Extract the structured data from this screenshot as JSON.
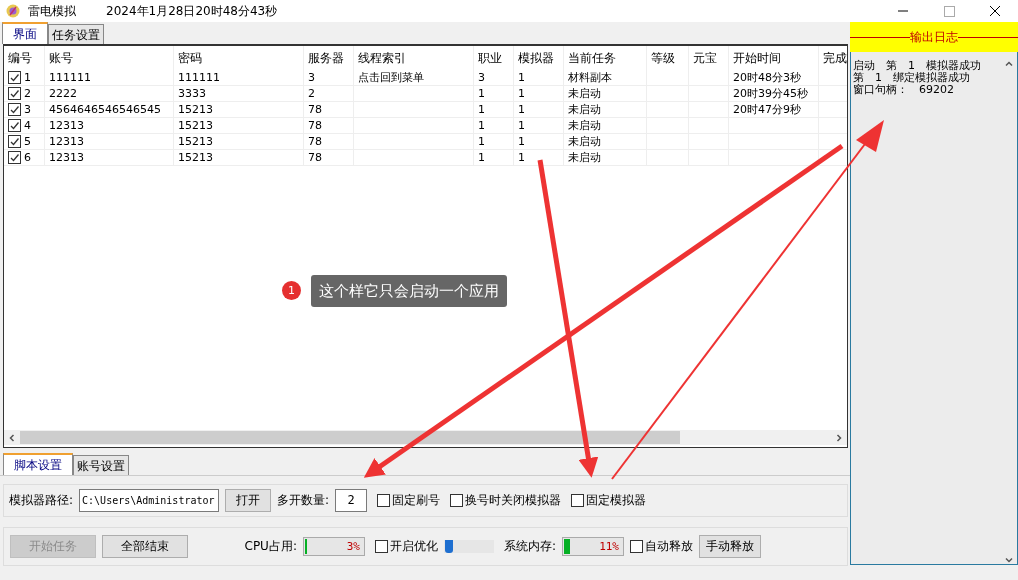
{
  "window": {
    "app_name": "雷电模拟",
    "timestamp": "2024年1月28日20时48分43秒"
  },
  "tabs": [
    {
      "label": "界面",
      "selected": true
    },
    {
      "label": "任务设置",
      "selected": false
    }
  ],
  "table": {
    "columns": [
      "编号",
      "账号",
      "密码",
      "服务器",
      "线程索引",
      "职业",
      "模拟器",
      "当前任务",
      "等级",
      "元宝",
      "开始时间",
      "完成"
    ],
    "rows": [
      {
        "checked": true,
        "cells": [
          "1",
          "111111",
          "111111",
          "3",
          "点击回到菜单",
          "3",
          "1",
          "材料副本",
          "",
          "",
          "20时48分3秒",
          ""
        ]
      },
      {
        "checked": true,
        "cells": [
          "2",
          "2222",
          "3333",
          "2",
          "",
          "1",
          "1",
          "未启动",
          "",
          "",
          "20时39分45秒",
          ""
        ]
      },
      {
        "checked": true,
        "cells": [
          "3",
          "4564646546546545",
          "15213",
          "78",
          "",
          "1",
          "1",
          "未启动",
          "",
          "",
          "20时47分9秒",
          ""
        ]
      },
      {
        "checked": true,
        "cells": [
          "4",
          "12313",
          "15213",
          "78",
          "",
          "1",
          "1",
          "未启动",
          "",
          "",
          "",
          ""
        ]
      },
      {
        "checked": true,
        "cells": [
          "5",
          "12313",
          "15213",
          "78",
          "",
          "1",
          "1",
          "未启动",
          "",
          "",
          "",
          ""
        ]
      },
      {
        "checked": true,
        "cells": [
          "6",
          "12313",
          "15213",
          "78",
          "",
          "1",
          "1",
          "未启动",
          "",
          "",
          "",
          ""
        ]
      }
    ]
  },
  "log": {
    "title": "输出日志",
    "lines": [
      "启动　第　1　模拟器成功",
      "第　1　绑定模拟器成功",
      "窗口句柄：　69202"
    ]
  },
  "bottom_tabs": [
    {
      "label": "脚本设置",
      "selected": true
    },
    {
      "label": "账号设置",
      "selected": false
    }
  ],
  "settings": {
    "path_label": "模拟器路径:",
    "path_value": "C:\\Users\\Administrator",
    "open_button": "打开",
    "count_label": "多开数量:",
    "count_value": "2",
    "options": [
      {
        "label": "固定刷号",
        "checked": false
      },
      {
        "label": "换号时关闭模拟器",
        "checked": false
      },
      {
        "label": "固定模拟器",
        "checked": false
      }
    ]
  },
  "controls": {
    "buttons": [
      {
        "label": "开始任务",
        "disabled": true
      },
      {
        "label": "全部结束",
        "disabled": false
      }
    ],
    "cpu": {
      "label": "CPU占用:",
      "level": 0.03,
      "reading": "3%"
    },
    "optimize": {
      "label": "开启优化",
      "checked": false
    },
    "slider": {
      "level": 0.03
    },
    "memory": {
      "label": "系统内存:",
      "level": 0.11,
      "reading": "11%"
    },
    "auto_release": {
      "label": "自动释放",
      "checked": false
    },
    "manual_button": "手动释放"
  },
  "annotation": {
    "number": "1",
    "text": "这个样它只会启动一个应用"
  }
}
